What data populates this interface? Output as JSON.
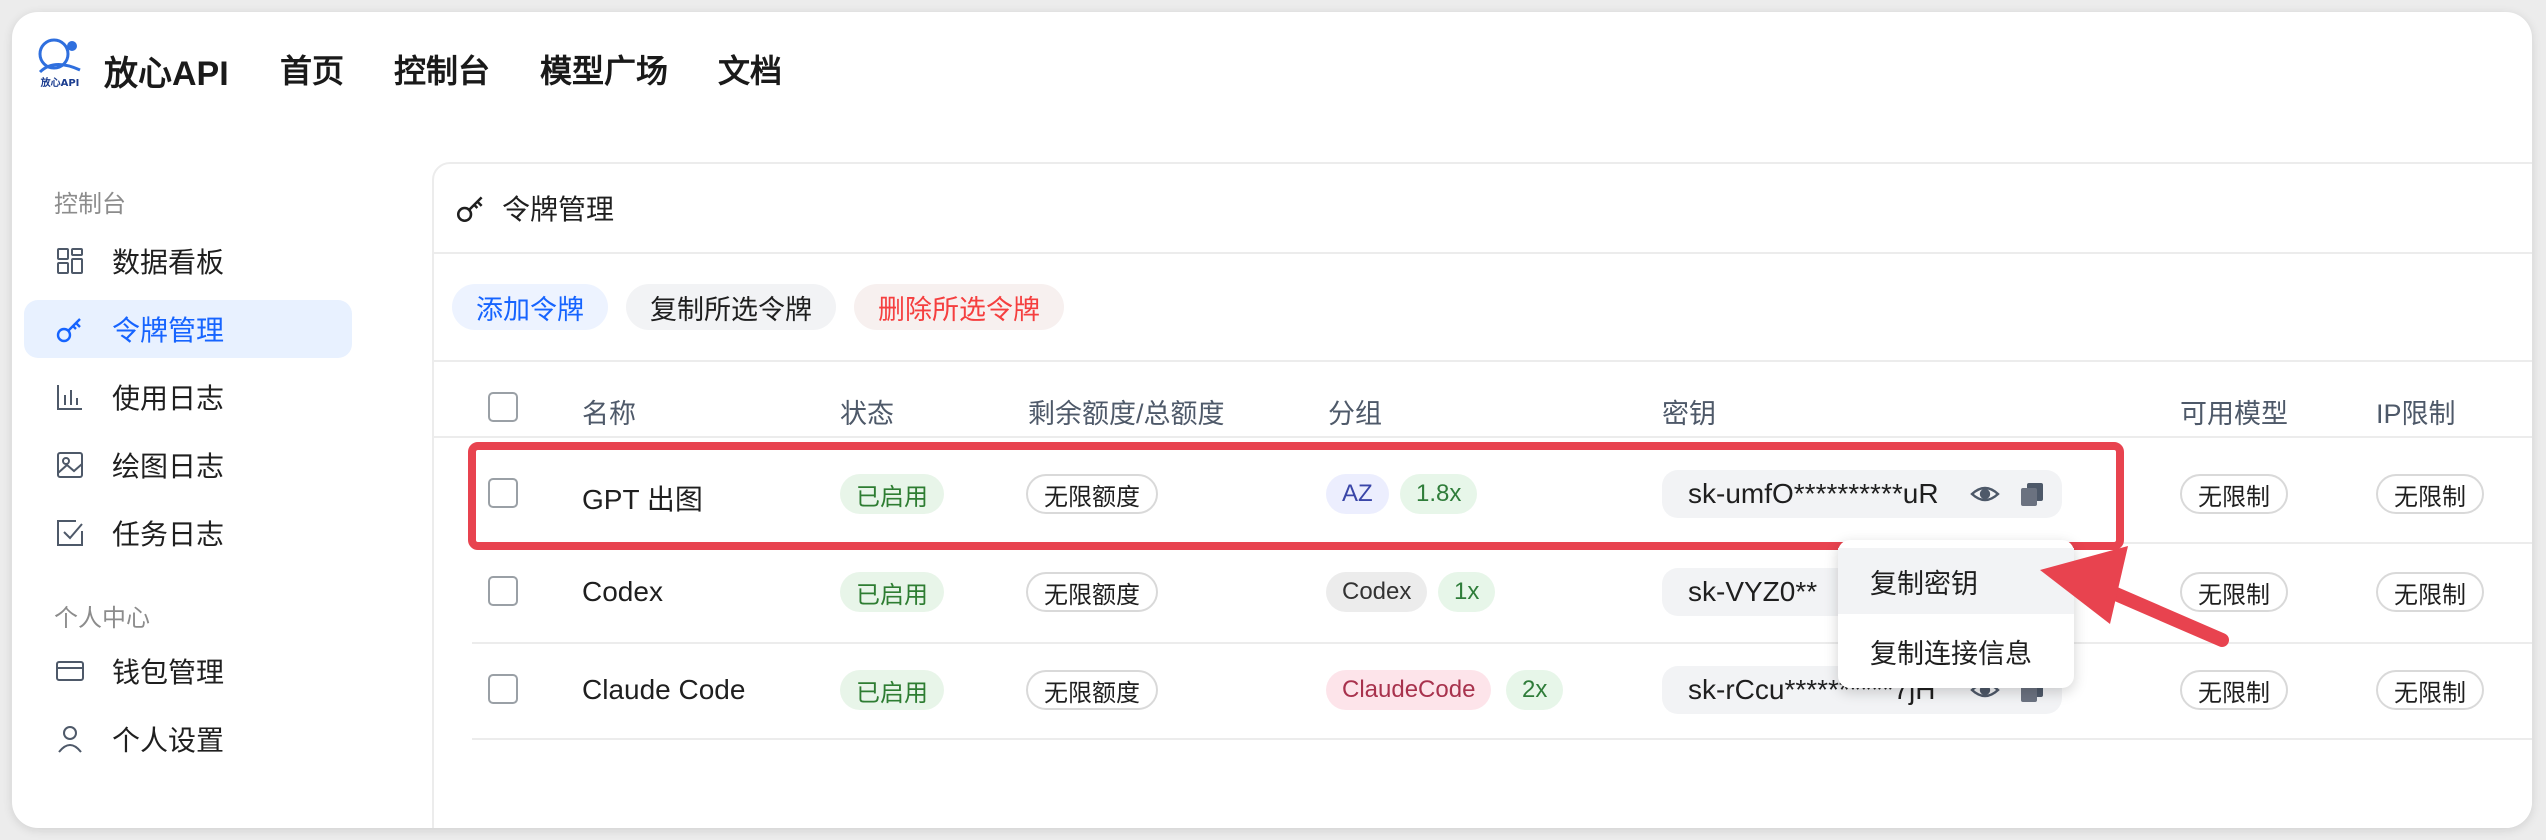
{
  "app": {
    "brand": "放心API",
    "logo_text": "放心API"
  },
  "nav": [
    "首页",
    "控制台",
    "模型广场",
    "文档"
  ],
  "sidebar": {
    "section1": "控制台",
    "items1": [
      {
        "label": "数据看板",
        "icon": "dashboard-icon"
      },
      {
        "label": "令牌管理",
        "icon": "key-icon",
        "active": true
      },
      {
        "label": "使用日志",
        "icon": "bar-chart-icon"
      },
      {
        "label": "绘图日志",
        "icon": "image-icon"
      },
      {
        "label": "任务日志",
        "icon": "check-square-icon"
      }
    ],
    "section2": "个人中心",
    "items2": [
      {
        "label": "钱包管理",
        "icon": "wallet-icon"
      },
      {
        "label": "个人设置",
        "icon": "user-icon"
      }
    ]
  },
  "card": {
    "title": "令牌管理"
  },
  "actions": {
    "add": "添加令牌",
    "copy_selected": "复制所选令牌",
    "delete_selected": "删除所选令牌"
  },
  "table": {
    "headers": [
      "名称",
      "状态",
      "剩余额度/总额度",
      "分组",
      "密钥",
      "可用模型",
      "IP限制"
    ],
    "rows": [
      {
        "name": "GPT 出图",
        "status": "已启用",
        "quota": "无限额度",
        "group": "AZ",
        "ratio": "1.8x",
        "key": "sk-umfO**********uR",
        "models": "无限制",
        "ip": "无限制"
      },
      {
        "name": "Codex",
        "status": "已启用",
        "quota": "无限额度",
        "group": "Codex",
        "ratio": "1x",
        "key": "sk-VYZ0**",
        "models": "无限制",
        "ip": "无限制"
      },
      {
        "name": "Claude Code",
        "status": "已启用",
        "quota": "无限额度",
        "group": "ClaudeCode",
        "ratio": "2x",
        "key": "sk-rCcu**********7jH",
        "models": "无限制",
        "ip": "无限制"
      }
    ]
  },
  "dropdown": {
    "copy_key": "复制密钥",
    "copy_conn": "复制连接信息"
  },
  "colors": {
    "accent": "#1664ff",
    "danger": "#f53f3f",
    "highlight": "#e8434f"
  }
}
